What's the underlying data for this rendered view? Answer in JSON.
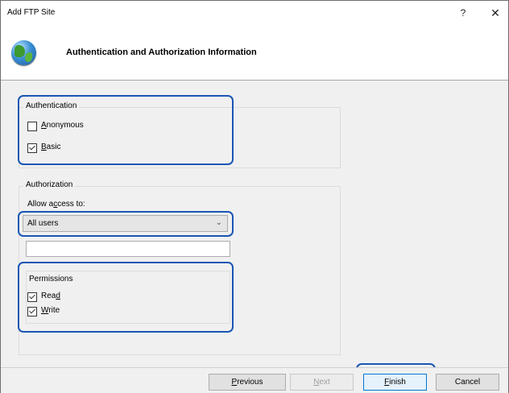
{
  "window": {
    "title": "Add FTP Site",
    "help_glyph": "?",
    "close_glyph": "✕"
  },
  "header": {
    "title": "Authentication and Authorization Information",
    "icon": "globe-icon"
  },
  "authentication": {
    "legend": "Authentication",
    "anonymous": {
      "label_accel": "A",
      "label_rest": "nonymous",
      "checked": false
    },
    "basic": {
      "label_accel": "B",
      "label_rest": "asic",
      "checked": true
    }
  },
  "authorization": {
    "legend": "Authorization",
    "allow_label_pre": "Allow a",
    "allow_label_accel": "c",
    "allow_label_post": "cess to:",
    "selected": "All users",
    "text_value": ""
  },
  "permissions": {
    "legend": "Permissions",
    "read": {
      "label_pre": "Rea",
      "label_accel": "d",
      "checked": true
    },
    "write": {
      "label_accel": "W",
      "label_rest": "rite",
      "checked": true
    }
  },
  "footer": {
    "previous": {
      "accel": "P",
      "rest": "revious"
    },
    "next": {
      "accel": "N",
      "rest": "ext"
    },
    "finish": {
      "accel": "F",
      "rest": "inish"
    },
    "cancel": "Cancel"
  },
  "colors": {
    "focus": "#1a56b5",
    "dialog_bg": "#f0f0f0"
  }
}
